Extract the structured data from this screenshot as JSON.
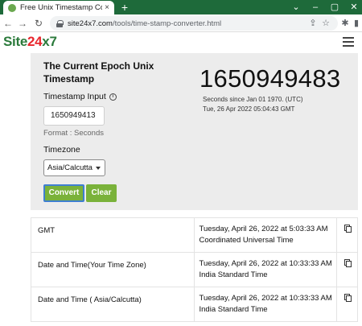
{
  "browser": {
    "tab_title": "Free Unix Timestamp Converter |",
    "new_tab": "+",
    "url_host": "site24x7.com",
    "url_path": "/tools/time-stamp-converter.html"
  },
  "site": {
    "logo_site": "Site",
    "logo_24": "24",
    "logo_x7": "x7",
    "brand_colors": {
      "green": "#2b7a3b",
      "red": "#e8262d",
      "button": "#7ab23a"
    }
  },
  "current": {
    "heading": "The Current Epoch Unix Timestamp",
    "epoch": "1650949483",
    "since": "Seconds since Jan 01 1970. (UTC)",
    "date": "Tue, 26 Apr 2022 05:04:43 GMT"
  },
  "form": {
    "timestamp_label": "Timestamp Input",
    "timestamp_value": "1650949413",
    "format_text": "Format : Seconds",
    "timezone_label": "Timezone",
    "timezone_value": "Asia/Calcutta",
    "convert_label": "Convert",
    "clear_label": "Clear"
  },
  "results": [
    {
      "label": "GMT",
      "value": "Tuesday, April 26, 2022 at 5:03:33 AM",
      "zone": "Coordinated Universal Time"
    },
    {
      "label": "Date and Time(Your Time Zone)",
      "value": "Tuesday, April 26, 2022 at 10:33:33 AM",
      "zone": "India Standard Time"
    },
    {
      "label": "Date and Time ( Asia/Calcutta)",
      "value": "Tuesday, April 26, 2022 at 10:33:33 AM",
      "zone": "India Standard Time"
    }
  ]
}
